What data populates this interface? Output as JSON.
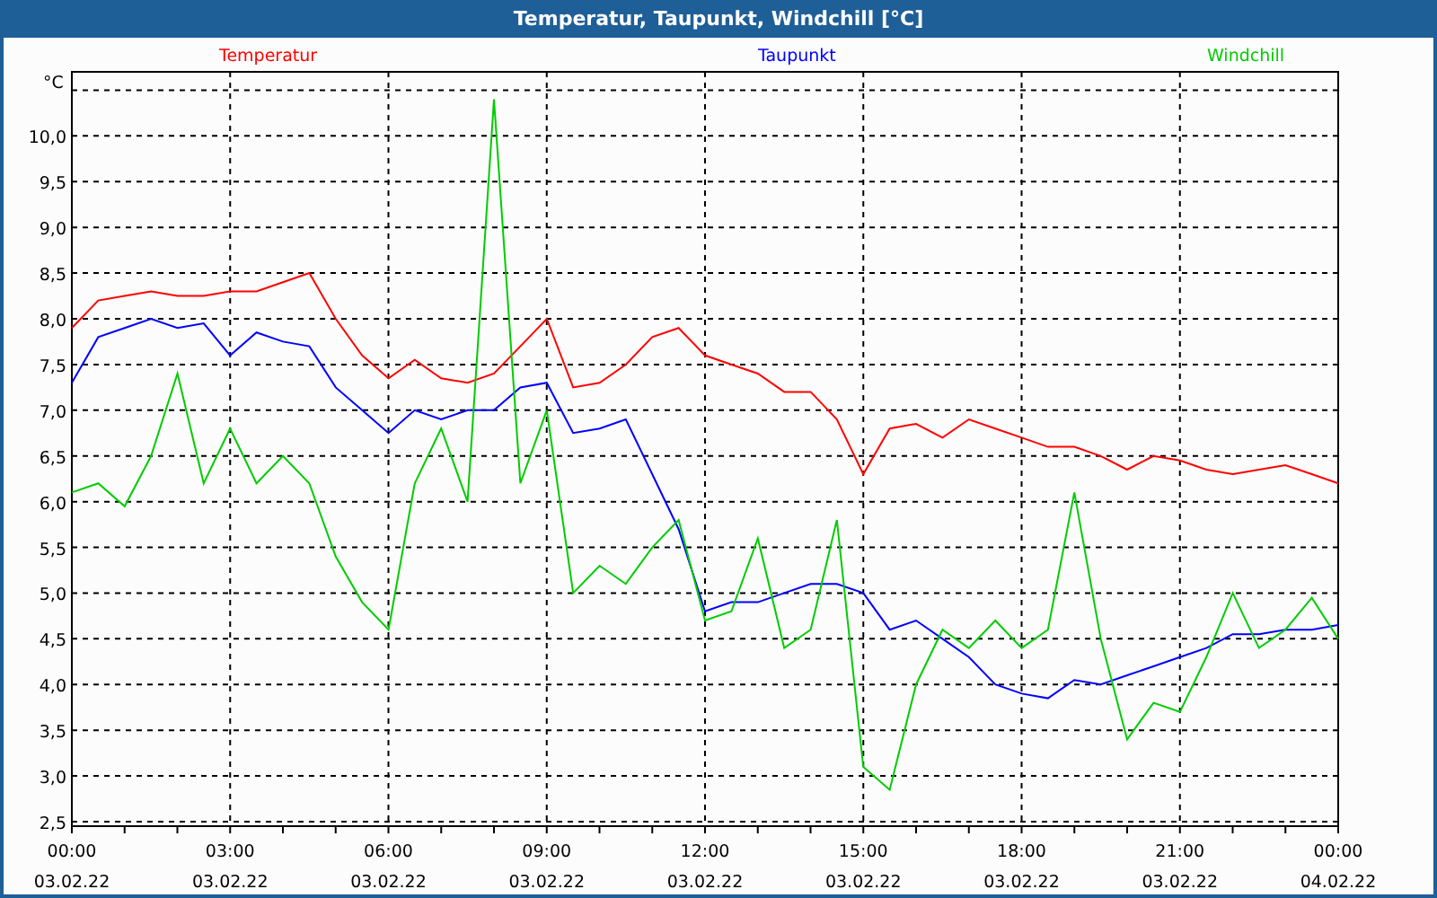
{
  "window": {
    "title": "Temperatur, Taupunkt, Windchill [°C]"
  },
  "chart": {
    "x_date_labels": [
      "03.02.22",
      "03.02.22",
      "03.02.22",
      "03.02.22",
      "03.02.22",
      "03.02.22",
      "03.02.22",
      "03.02.22",
      "04.02.22"
    ],
    "chart_data": {
      "type": "line",
      "ylabel": "°C",
      "x": [
        0,
        0.5,
        1,
        1.5,
        2,
        2.5,
        3,
        3.5,
        4,
        4.5,
        5,
        5.5,
        6,
        6.5,
        7,
        7.5,
        8,
        8.5,
        9,
        9.5,
        10,
        10.5,
        11,
        11.5,
        12,
        12.5,
        13,
        13.5,
        14,
        14.5,
        15,
        15.5,
        16,
        16.5,
        17,
        17.5,
        18,
        18.5,
        19,
        19.5,
        20,
        20.5,
        21,
        21.5,
        22,
        22.5,
        23,
        23.5,
        24
      ],
      "series": [
        {
          "name": "Temperatur",
          "color": "#ff0000",
          "values": [
            7.9,
            8.2,
            8.25,
            8.3,
            8.25,
            8.25,
            8.3,
            8.3,
            8.4,
            8.5,
            8.0,
            7.6,
            7.35,
            7.55,
            7.35,
            7.3,
            7.4,
            7.7,
            8.0,
            7.25,
            7.3,
            7.5,
            7.8,
            7.9,
            7.6,
            7.5,
            7.4,
            7.2,
            7.2,
            6.9,
            6.3,
            6.8,
            6.85,
            6.7,
            6.9,
            6.8,
            6.7,
            6.6,
            6.6,
            6.5,
            6.35,
            6.5,
            6.45,
            6.35,
            6.3,
            6.35,
            6.4,
            6.3,
            6.2
          ]
        },
        {
          "name": "Taupunkt",
          "color": "#0000ff",
          "values": [
            7.3,
            7.8,
            7.9,
            8.0,
            7.9,
            7.95,
            7.6,
            7.85,
            7.75,
            7.7,
            7.25,
            7.0,
            6.75,
            7.0,
            6.9,
            7.0,
            7.0,
            7.25,
            7.3,
            6.75,
            6.8,
            6.9,
            6.3,
            5.7,
            4.8,
            4.9,
            4.9,
            5.0,
            5.1,
            5.1,
            5.0,
            4.6,
            4.7,
            4.5,
            4.3,
            4.0,
            3.9,
            3.85,
            4.05,
            4.0,
            4.1,
            4.2,
            4.3,
            4.4,
            4.55,
            4.55,
            4.6,
            4.6,
            4.65
          ]
        },
        {
          "name": "Windchill",
          "color": "#00cc00",
          "values": [
            6.1,
            6.2,
            5.95,
            6.5,
            7.4,
            6.2,
            6.8,
            6.2,
            6.5,
            6.2,
            5.4,
            4.9,
            4.6,
            6.2,
            6.8,
            6.0,
            10.4,
            6.2,
            7.0,
            5.0,
            5.3,
            5.1,
            5.5,
            5.8,
            4.7,
            4.8,
            5.6,
            4.4,
            4.6,
            5.8,
            3.1,
            2.85,
            4.0,
            4.6,
            4.4,
            4.7,
            4.4,
            4.6,
            6.1,
            4.5,
            3.4,
            3.8,
            3.7,
            4.3,
            5.0,
            4.4,
            4.6,
            4.95,
            4.5
          ]
        }
      ],
      "grid": true,
      "xlim": [
        0,
        24
      ],
      "ylim": [
        2.5,
        10.75
      ],
      "xticks": [
        {
          "value": 0,
          "label": "00:00"
        },
        {
          "value": 3,
          "label": "03:00"
        },
        {
          "value": 6,
          "label": "06:00"
        },
        {
          "value": 9,
          "label": "09:00"
        },
        {
          "value": 12,
          "label": "12:00"
        },
        {
          "value": 15,
          "label": "15:00"
        },
        {
          "value": 18,
          "label": "18:00"
        },
        {
          "value": 21,
          "label": "21:00"
        },
        {
          "value": 24,
          "label": "00:00"
        }
      ],
      "yticks": [
        {
          "value": 2.5,
          "label": "2,5"
        },
        {
          "value": 3,
          "label": "3,0"
        },
        {
          "value": 3.5,
          "label": "3,5"
        },
        {
          "value": 4,
          "label": "4,0"
        },
        {
          "value": 4.5,
          "label": "4,5"
        },
        {
          "value": 5,
          "label": "5,0"
        },
        {
          "value": 5.5,
          "label": "5,5"
        },
        {
          "value": 6,
          "label": "6,0"
        },
        {
          "value": 6.5,
          "label": "6,5"
        },
        {
          "value": 7,
          "label": "7,0"
        },
        {
          "value": 7.5,
          "label": "7,5"
        },
        {
          "value": 8,
          "label": "8,0"
        },
        {
          "value": 8.5,
          "label": "8,5"
        },
        {
          "value": 9,
          "label": "9,0"
        },
        {
          "value": 9.5,
          "label": "9,5"
        },
        {
          "value": 10,
          "label": "10,0"
        }
      ]
    }
  }
}
